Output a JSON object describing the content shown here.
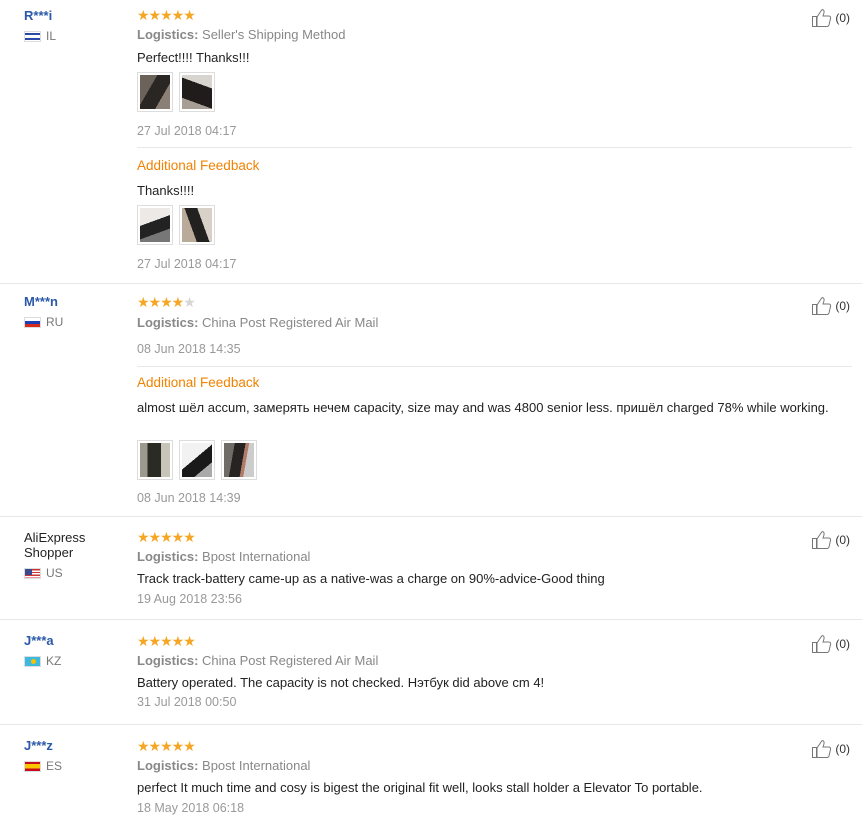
{
  "reviews": [
    {
      "name": "R***i",
      "country": "IL",
      "stars": 5,
      "logistics_label": "Logistics:",
      "logistics": "Seller's Shipping Method",
      "text": "Perfect!!!! Thanks!!!",
      "date": "27 Jul 2018 04:17",
      "additional_label": "Additional Feedback",
      "additional_text": "Thanks!!!!",
      "additional_date": "27 Jul 2018 04:17",
      "likes": "(0)"
    },
    {
      "name": "M***n",
      "country": "RU",
      "stars": 4,
      "logistics_label": "Logistics:",
      "logistics": "China Post Registered Air Mail",
      "date": "08 Jun 2018 14:35",
      "additional_label": "Additional Feedback",
      "additional_text": "almost шёл accum, замерять нечем capacity, size may and was 4800 senior less. пришёл charged 78% while working.",
      "additional_date": "08 Jun 2018 14:39",
      "likes": "(0)"
    },
    {
      "name": "AliExpress Shopper",
      "country": "US",
      "stars": 5,
      "logistics_label": "Logistics:",
      "logistics": "Bpost International",
      "text": "Track track-battery came-up as a native-was a charge on 90%-advice-Good thing",
      "date": "19 Aug 2018 23:56",
      "likes": "(0)"
    },
    {
      "name": "J***a",
      "country": "KZ",
      "stars": 5,
      "logistics_label": "Logistics:",
      "logistics": "China Post Registered Air Mail",
      "text": "Battery operated. The capacity is not checked. Нэтбук did above cm 4!",
      "date": "31 Jul 2018 00:50",
      "likes": "(0)"
    },
    {
      "name": "J***z",
      "country": "ES",
      "stars": 5,
      "logistics_label": "Logistics:",
      "logistics": "Bpost International",
      "text": "perfect It much time and cosy is bigest the original fit well, looks stall holder a Elevator To portable.",
      "date": "18 May 2018 06:18",
      "likes": "(0)"
    }
  ],
  "colors": {
    "star": "#f5a623",
    "username": "#2a59a8",
    "additional": "#f08200"
  },
  "icons": {
    "like": "thumbs-up-icon",
    "star": "star-icon"
  }
}
